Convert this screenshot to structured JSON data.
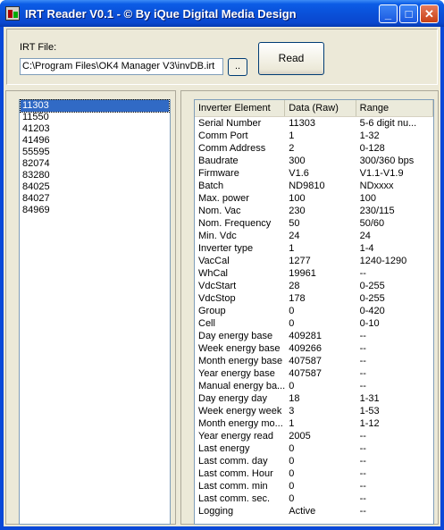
{
  "window": {
    "title": "IRT Reader V0.1 - © By iQue Digital Media Design",
    "controls": {
      "minimize": "_",
      "maximize": "□",
      "close": "✕"
    }
  },
  "file": {
    "label": "IRT File:",
    "path": "C:\\Program Files\\OK4 Manager V3\\invDB.irt",
    "browse_label": "..",
    "read_label": "Read"
  },
  "inverter_list": [
    "11303",
    "11550",
    "41203",
    "41496",
    "55595",
    "82074",
    "83280",
    "84025",
    "84027",
    "84969"
  ],
  "selected_inverter": "11303",
  "table": {
    "headers": [
      "Inverter Element",
      "Data (Raw)",
      "Range"
    ],
    "rows": [
      [
        "Serial Number",
        "11303",
        "5-6 digit nu..."
      ],
      [
        "Comm Port",
        "1",
        "1-32"
      ],
      [
        "Comm Address",
        "2",
        "0-128"
      ],
      [
        "Baudrate",
        "300",
        "300/360 bps"
      ],
      [
        "Firmware",
        "V1.6",
        "V1.1-V1.9"
      ],
      [
        "Batch",
        "ND9810",
        "NDxxxx"
      ],
      [
        "Max. power",
        "100",
        "100"
      ],
      [
        "Nom. Vac",
        "230",
        "230/115"
      ],
      [
        "Nom. Frequency",
        "50",
        "50/60"
      ],
      [
        "Min. Vdc",
        "24",
        "24"
      ],
      [
        "Inverter type",
        "1",
        "1-4"
      ],
      [
        "VacCal",
        "1277",
        "1240-1290"
      ],
      [
        "WhCal",
        "19961",
        "--"
      ],
      [
        "VdcStart",
        "28",
        "0-255"
      ],
      [
        "VdcStop",
        "178",
        "0-255"
      ],
      [
        "Group",
        "0",
        "0-420"
      ],
      [
        "Cell",
        "0",
        "0-10"
      ],
      [
        "Day energy base",
        "409281",
        "--"
      ],
      [
        "Week energy base",
        "409266",
        "--"
      ],
      [
        "Month energy base",
        "407587",
        "--"
      ],
      [
        "Year energy base",
        "407587",
        "--"
      ],
      [
        "Manual energy ba...",
        "0",
        "--"
      ],
      [
        "Day energy day",
        "18",
        "1-31"
      ],
      [
        "Week energy week",
        "3",
        "1-53"
      ],
      [
        "Month energy mo...",
        "1",
        "1-12"
      ],
      [
        "Year energy read",
        "2005",
        "--"
      ],
      [
        "Last energy",
        "0",
        "--"
      ],
      [
        "Last comm. day",
        "0",
        "--"
      ],
      [
        "Last comm. Hour",
        "0",
        "--"
      ],
      [
        "Last comm. min",
        "0",
        "--"
      ],
      [
        "Last comm. sec.",
        "0",
        "--"
      ],
      [
        "Logging",
        "Active",
        "--"
      ]
    ]
  }
}
